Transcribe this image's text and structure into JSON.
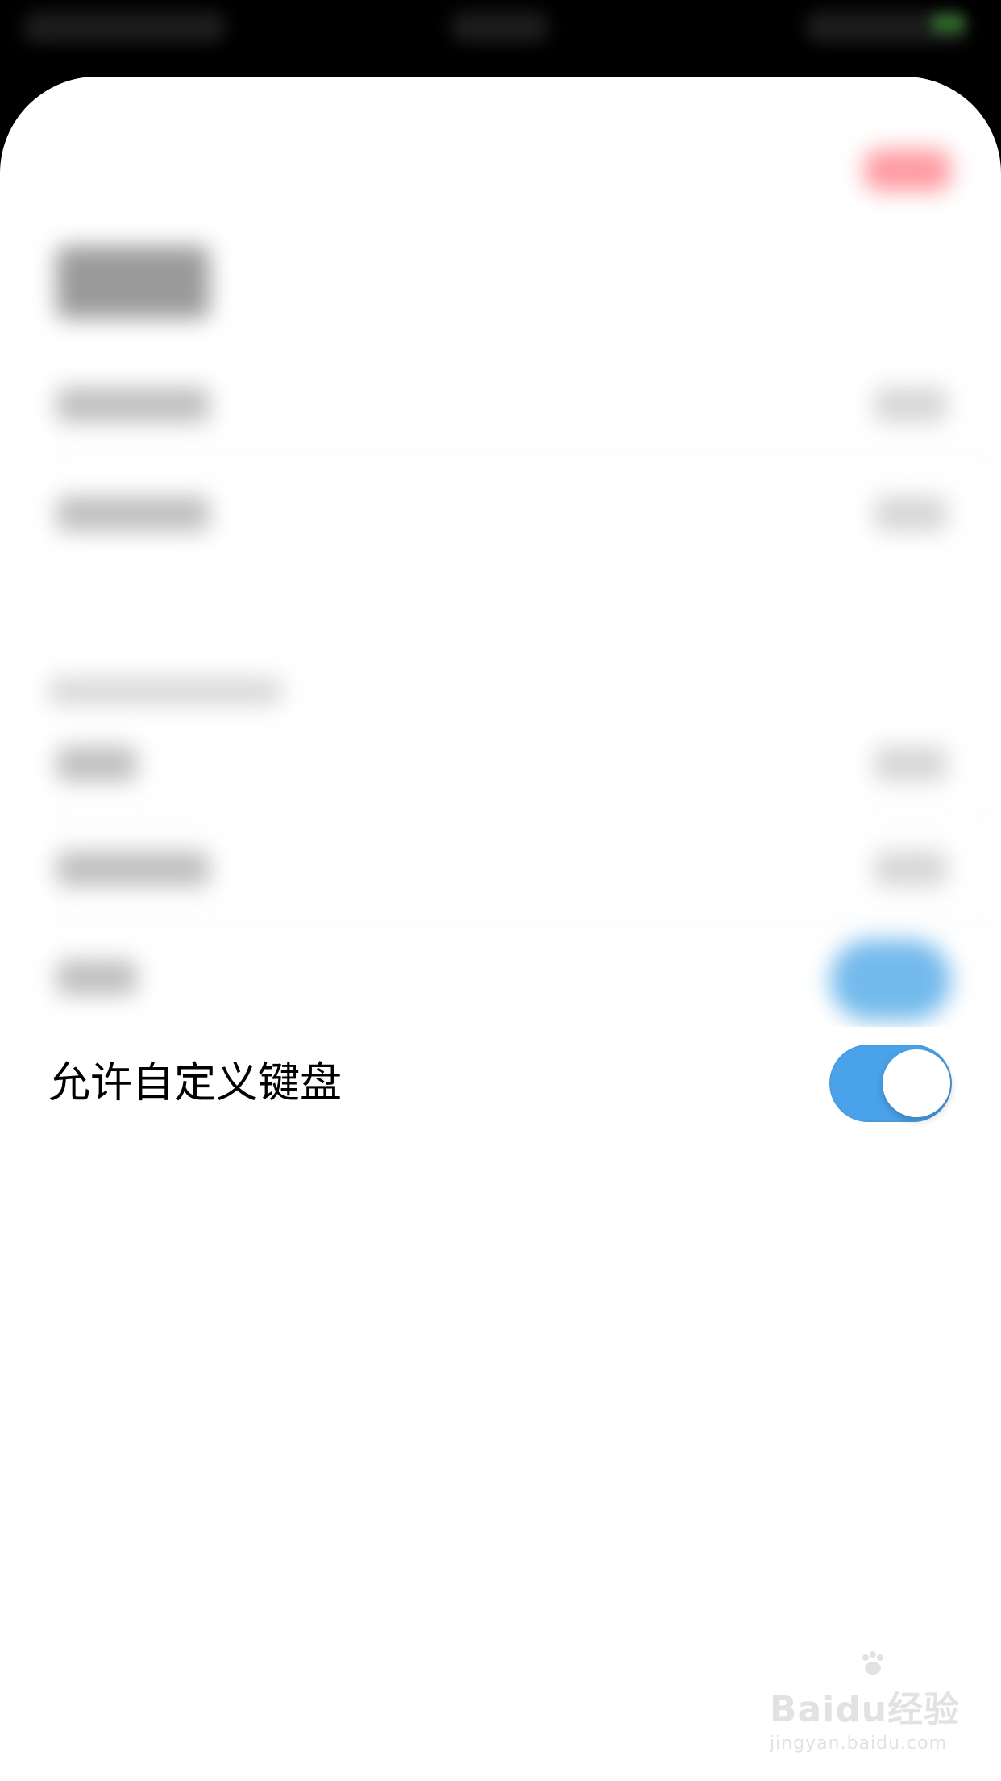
{
  "setting_row": {
    "label": "允许自定义键盘",
    "toggle_on": true,
    "toggle_color": "#4aa3ea"
  },
  "watermark": {
    "brand": "Baidu经验",
    "domain": "jingyan.baidu.com"
  },
  "icons": {
    "watermark_logo": "paw-icon"
  }
}
